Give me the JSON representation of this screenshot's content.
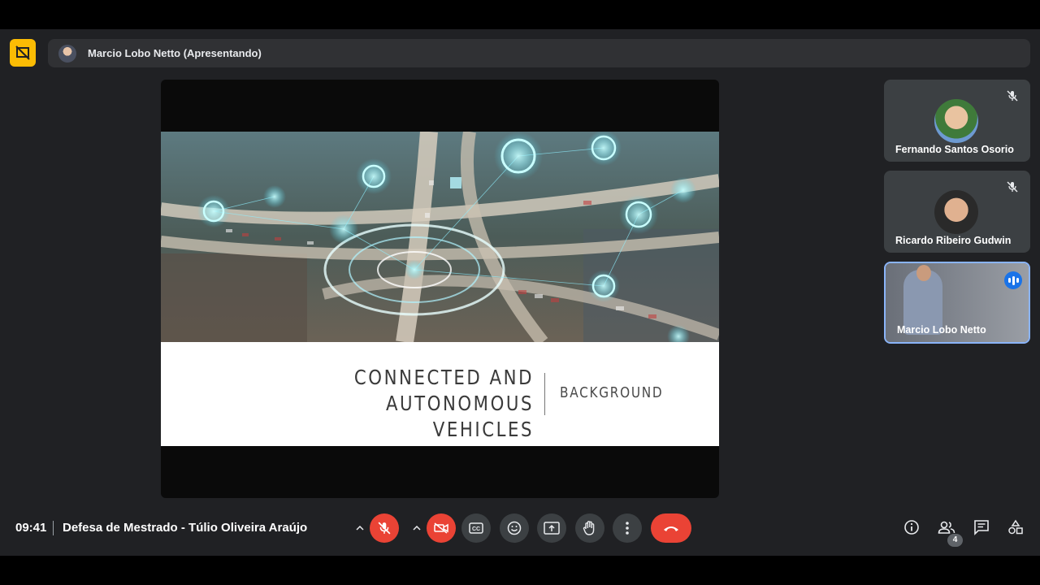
{
  "presenter": {
    "label": "Marcio Lobo Netto (Apresentando)"
  },
  "slide": {
    "title_line1": "CONNECTED AND AUTONOMOUS",
    "title_line2": "VEHICLES",
    "subtitle": "BACKGROUND"
  },
  "participants": [
    {
      "name": "Fernando Santos Osorio",
      "muted": true
    },
    {
      "name": "Ricardo Ribeiro Gudwin",
      "muted": true
    },
    {
      "name": "Marcio Lobo Netto",
      "speaking": true
    }
  ],
  "meeting": {
    "time": "09:41",
    "title": "Defesa de Mestrado - Túlio Oliveira Araújo"
  },
  "people_count": "4",
  "colors": {
    "accent_red": "#ea4335",
    "presenter_yellow": "#fbbc04",
    "speaking_blue": "#1a73e8"
  }
}
